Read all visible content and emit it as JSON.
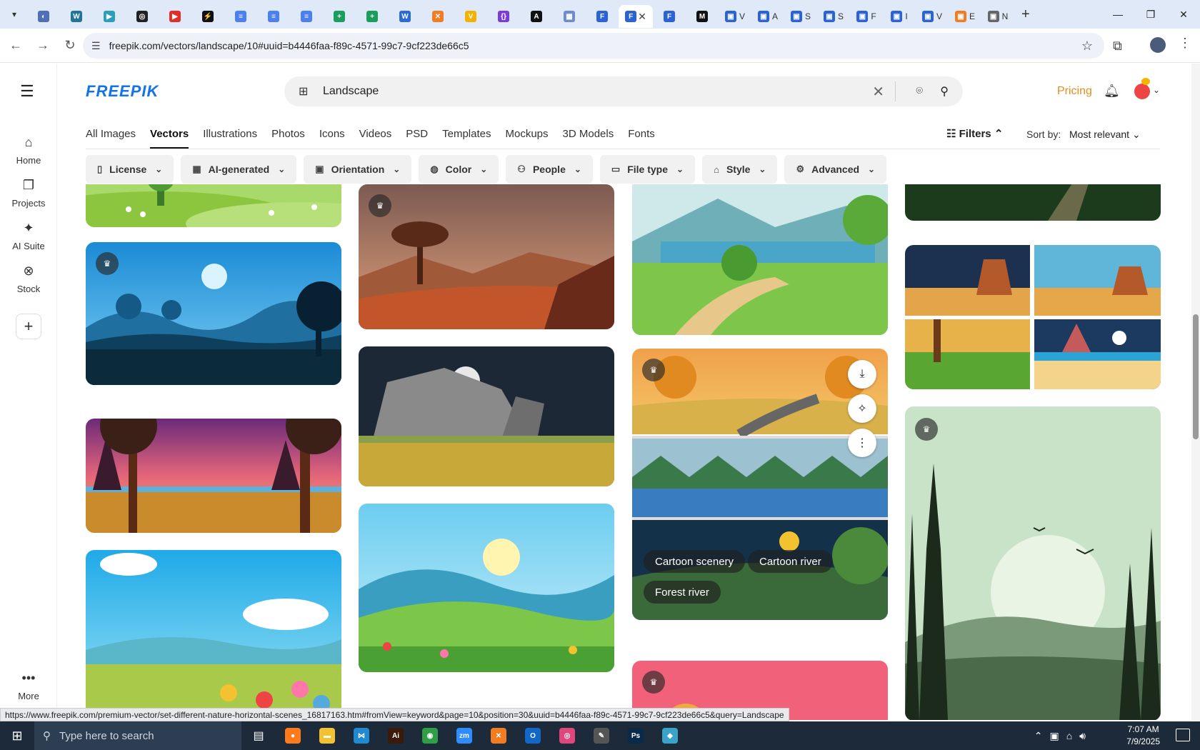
{
  "browser": {
    "tab_favicons": [
      {
        "name": "globe-tab",
        "color": "#4f6fb8",
        "glyph": "◐"
      },
      {
        "name": "wordpress-tab",
        "color": "#21759b",
        "glyph": "W"
      },
      {
        "name": "app-tab",
        "color": "#2aa0b8",
        "glyph": "▶"
      },
      {
        "name": "openai-tab",
        "color": "#222222",
        "glyph": "◎"
      },
      {
        "name": "youtube-tab",
        "color": "#e52d27",
        "glyph": "▶"
      },
      {
        "name": "bolt-tab",
        "color": "#111111",
        "glyph": "⚡"
      },
      {
        "name": "docs-tab",
        "color": "#4a80f0",
        "glyph": "≡"
      },
      {
        "name": "docs-tab-2",
        "color": "#4a80f0",
        "glyph": "≡"
      },
      {
        "name": "docs-tab-3",
        "color": "#4a80f0",
        "glyph": "≡"
      },
      {
        "name": "sheets-tab",
        "color": "#1a9e5c",
        "glyph": "+"
      },
      {
        "name": "sheets-tab-2",
        "color": "#1a9e5c",
        "glyph": "+"
      },
      {
        "name": "word-tab",
        "color": "#2b6cd4",
        "glyph": "W"
      },
      {
        "name": "xampp-tab",
        "color": "#f27c22",
        "glyph": "✕"
      },
      {
        "name": "vue-tab",
        "color": "#f5b000",
        "glyph": "V"
      },
      {
        "name": "code-tab",
        "color": "#7a3cd6",
        "glyph": "{}"
      },
      {
        "name": "a-tab",
        "color": "#111111",
        "glyph": "A"
      },
      {
        "name": "grid-tab",
        "color": "#6c8ccc",
        "glyph": "▦"
      },
      {
        "name": "freepik-tab",
        "color": "#2a63d6",
        "glyph": "F"
      },
      {
        "name": "freepik-tab-active",
        "color": "#2a63d6",
        "glyph": "F"
      },
      {
        "name": "freepik-tab-2",
        "color": "#2a63d6",
        "glyph": "F"
      },
      {
        "name": "m-tab",
        "color": "#111111",
        "glyph": "M"
      }
    ],
    "titled_tabs": [
      {
        "letter": "V",
        "color": "#2a63d6"
      },
      {
        "letter": "A",
        "color": "#2a63d6"
      },
      {
        "letter": "S",
        "color": "#2a63d6"
      },
      {
        "letter": "S",
        "color": "#2a63d6"
      },
      {
        "letter": "F",
        "color": "#2a63d6"
      },
      {
        "letter": "I",
        "color": "#2a63d6"
      },
      {
        "letter": "V",
        "color": "#2a63d6"
      },
      {
        "letter": "E",
        "color": "#f27c22"
      },
      {
        "letter": "N",
        "color": "#666666"
      }
    ],
    "url": "freepik.com/vectors/landscape/10#uuid=b4446faa-f89c-4571-99c7-9cf223de66c5"
  },
  "sidebar": {
    "items": [
      {
        "label": "Home",
        "icon": "home-icon",
        "glyph": "⌂"
      },
      {
        "label": "Projects",
        "icon": "projects-icon",
        "glyph": "❐"
      },
      {
        "label": "AI Suite",
        "icon": "sparkle-icon",
        "glyph": "✦"
      },
      {
        "label": "Stock",
        "icon": "stock-icon",
        "glyph": "⊗"
      }
    ],
    "more_label": "More"
  },
  "header": {
    "logo": "FREEPIK",
    "search_value": "Landscape",
    "pricing": "Pricing"
  },
  "categories": [
    "All Images",
    "Vectors",
    "Illustrations",
    "Photos",
    "Icons",
    "Videos",
    "PSD",
    "Templates",
    "Mockups",
    "3D Models",
    "Fonts"
  ],
  "active_category": "Vectors",
  "toolbar": {
    "filters_label": "Filters",
    "sort_label": "Sort by:",
    "sort_value": "Most relevant"
  },
  "chips": [
    {
      "label": "License",
      "glyph": "▯"
    },
    {
      "label": "AI-generated",
      "glyph": "▦"
    },
    {
      "label": "Orientation",
      "glyph": "▣"
    },
    {
      "label": "Color",
      "glyph": "◍"
    },
    {
      "label": "People",
      "glyph": "⚇"
    },
    {
      "label": "File type",
      "glyph": "▭"
    },
    {
      "label": "Style",
      "glyph": "⌂"
    },
    {
      "label": "Advanced",
      "glyph": "⚙"
    }
  ],
  "hover_card": {
    "tags": [
      "Cartoon scenery",
      "Cartoon river",
      "Forest river"
    ]
  },
  "status_url": "https://www.freepik.com/premium-vector/set-different-nature-horizontal-scenes_16817163.htm#fromView=keyword&page=10&position=30&uuid=b4446faa-f89c-4571-99c7-9cf223de66c5&query=Landscape",
  "taskbar": {
    "search_placeholder": "Type here to search",
    "time": "7:07 AM",
    "date": "7/9/2025",
    "apps": [
      {
        "name": "firefox-taskbar",
        "color": "#ff7a1a",
        "glyph": "●"
      },
      {
        "name": "explorer-taskbar",
        "color": "#f2c230",
        "glyph": "▬"
      },
      {
        "name": "vscode-taskbar",
        "color": "#1f8ad2",
        "glyph": "⋈"
      },
      {
        "name": "illustrator-taskbar",
        "color": "#3b1a0a",
        "glyph": "Ai"
      },
      {
        "name": "chrome-taskbar",
        "color": "#2f9e44",
        "glyph": "◉"
      },
      {
        "name": "zoom-taskbar",
        "color": "#2d8cff",
        "glyph": "zm"
      },
      {
        "name": "xampp-taskbar",
        "color": "#f27c22",
        "glyph": "✕"
      },
      {
        "name": "outlook-taskbar",
        "color": "#1168c8",
        "glyph": "O"
      },
      {
        "name": "creative-cloud-taskbar",
        "color": "#e0457b",
        "glyph": "◎"
      },
      {
        "name": "pen-taskbar",
        "color": "#555555",
        "glyph": "✎"
      },
      {
        "name": "photoshop-taskbar",
        "color": "#0a2a4a",
        "glyph": "Ps"
      },
      {
        "name": "app-taskbar",
        "color": "#3aa3c9",
        "glyph": "◆"
      }
    ]
  }
}
